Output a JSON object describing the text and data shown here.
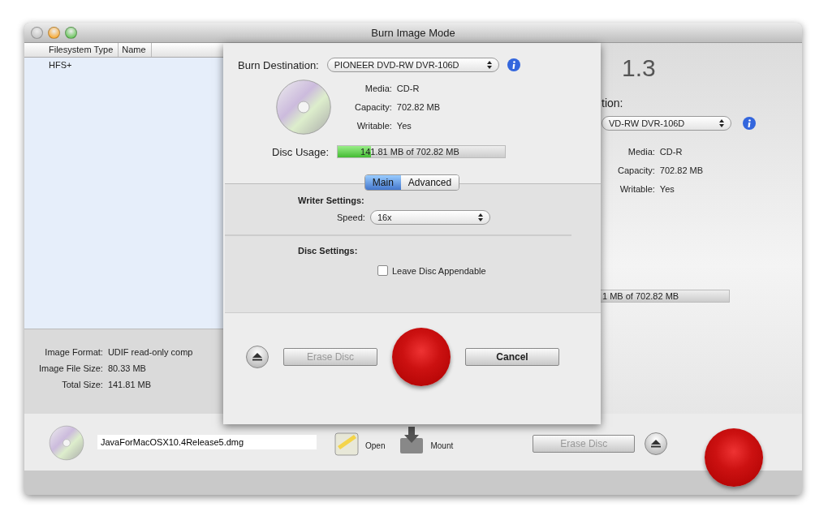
{
  "window": {
    "title": "Burn Image Mode"
  },
  "file_list": {
    "columns": [
      "Filesystem Type",
      "Name"
    ],
    "rows": [
      {
        "filesystem_type": "HFS+"
      }
    ]
  },
  "image_info": [
    {
      "label": "Image Format:",
      "value": "UDIF read-only comp"
    },
    {
      "label": "Image File Size:",
      "value": "80.33 MB"
    },
    {
      "label": "Total Size:",
      "value": "141.81 MB"
    }
  ],
  "background_panel": {
    "heading": "1.3",
    "destination_label": "tion:",
    "device": "VD-RW DVR-106D",
    "info": [
      {
        "label": "Media:",
        "value": "CD-R"
      },
      {
        "label": "Capacity:",
        "value": "702.82 MB"
      },
      {
        "label": "Writable:",
        "value": "Yes"
      }
    ],
    "usage_text": "1 MB of 702.82 MB"
  },
  "sheet": {
    "destination_label": "Burn Destination:",
    "device": "PIONEER DVD-RW DVR-106D",
    "info": [
      {
        "label": "Media:",
        "value": "CD-R"
      },
      {
        "label": "Capacity:",
        "value": "702.82 MB"
      },
      {
        "label": "Writable:",
        "value": "Yes"
      }
    ],
    "usage_label": "Disc Usage:",
    "usage": {
      "text": "141.81 MB of 702.82 MB",
      "level": 0.2
    },
    "tabs": [
      {
        "label": "Main",
        "selected": true
      },
      {
        "label": "Advanced",
        "selected": false
      }
    ],
    "writer_heading": "Writer Settings:",
    "speed_label": "Speed:",
    "speed_value": "16x",
    "disc_heading": "Disc Settings:",
    "appendable": {
      "label": "Leave Disc Appendable",
      "checked": false
    },
    "erase_button": {
      "label": "Erase Disc",
      "disabled": true
    },
    "cancel_button": {
      "label": "Cancel",
      "disabled": false
    }
  },
  "bottom_bar": {
    "filename": "JavaForMacOSX10.4Release5.dmg",
    "open_label": "Open",
    "mount_label": "Mount",
    "erase_button": {
      "label": "Erase Disc",
      "disabled": true
    }
  }
}
